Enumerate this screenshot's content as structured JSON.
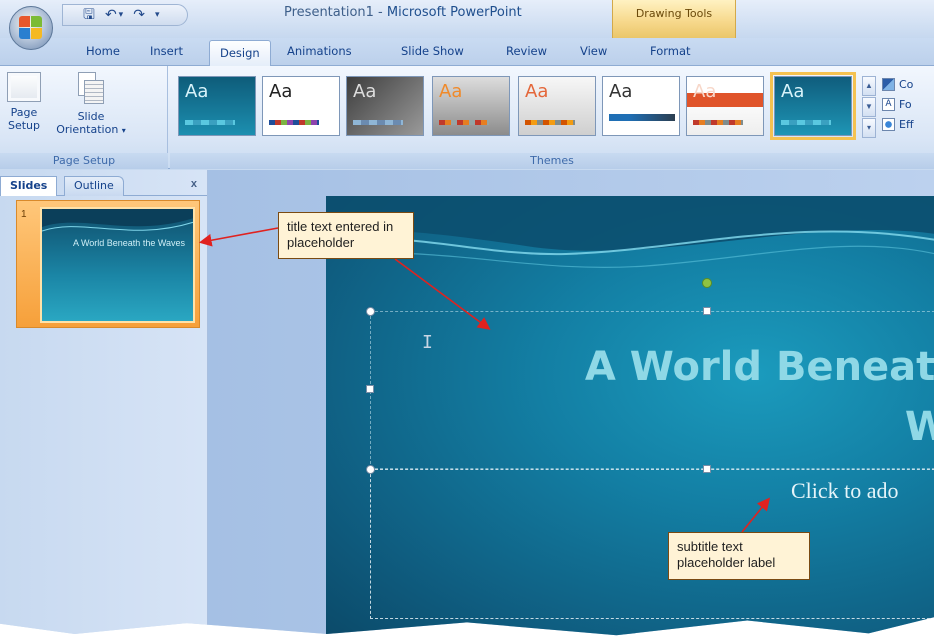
{
  "titlebar": {
    "doc_name": "Presentation1",
    "separator": " - ",
    "app_name": "Microsoft PowerPoint",
    "context_group": "Drawing Tools"
  },
  "qat": {
    "save": "🖫",
    "undo": "↶",
    "undo_drop": "▾",
    "redo": "↷",
    "customize": "▾"
  },
  "tabs": [
    "Home",
    "Insert",
    "Design",
    "Animations",
    "Slide Show",
    "Review",
    "View",
    "Format"
  ],
  "active_tab": "Design",
  "ribbon": {
    "page_setup": {
      "page_setup_line1": "Page",
      "page_setup_line2": "Setup",
      "orientation_line1": "Slide",
      "orientation_line2": "Orientation",
      "orientation_arrow": "▾",
      "group_label": "Page Setup"
    },
    "themes": {
      "group_label": "Themes",
      "thumb_text": "Aa",
      "scroll_up": "▲",
      "scroll_down": "▼",
      "more": "▾",
      "options": [
        {
          "label": "Co",
          "icon": "colors-icon"
        },
        {
          "label": "Fo",
          "icon": "fonts-icon",
          "glyph": "A"
        },
        {
          "label": "Eff",
          "icon": "effects-icon"
        }
      ]
    }
  },
  "slides_pane": {
    "tab_slides": "Slides",
    "tab_outline": "Outline",
    "close": "x",
    "slide_number": "1",
    "thumb_title": "A World Beneath the Waves"
  },
  "slide": {
    "title_line1": "A World Beneatl",
    "title_line2": "W",
    "subtitle_placeholder": "Click to ado",
    "ibeam": "I"
  },
  "callouts": {
    "title": "title text entered in placeholder",
    "subtitle": "subtitle text placeholder label"
  },
  "colors": {
    "ribbon_accent": "#15428b",
    "callout_bg": "#fff3d6",
    "arrow": "#e0221f",
    "selected_theme_outline": "#f4c251"
  }
}
